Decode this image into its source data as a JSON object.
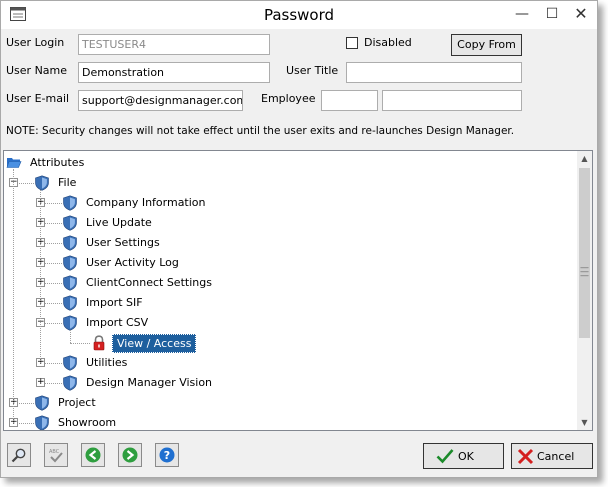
{
  "window": {
    "title": "Password"
  },
  "form": {
    "login_label": "User Login",
    "login_value": "TESTUSER4",
    "disabled_label": "Disabled",
    "disabled_checked": false,
    "copy_from_label": "Copy From",
    "name_label": "User Name",
    "name_value": "Demonstration",
    "title_label": "User Title",
    "title_value": "",
    "email_label": "User E-mail",
    "email_value": "support@designmanager.com",
    "employee_label": "Employee",
    "employee_code": "",
    "employee_name": ""
  },
  "note": "NOTE: Security changes will not take effect until the user exits and re-launches Design Manager.",
  "tree": {
    "root": "Attributes",
    "nodes": [
      {
        "label": "File",
        "level": 1,
        "expanded": true
      },
      {
        "label": "Company Information",
        "level": 2,
        "expanded": false
      },
      {
        "label": "Live Update",
        "level": 2,
        "expanded": false
      },
      {
        "label": "User Settings",
        "level": 2,
        "expanded": false
      },
      {
        "label": "User Activity Log",
        "level": 2,
        "expanded": false
      },
      {
        "label": "ClientConnect Settings",
        "level": 2,
        "expanded": false
      },
      {
        "label": "Import SIF",
        "level": 2,
        "expanded": false
      },
      {
        "label": "Import CSV",
        "level": 2,
        "expanded": true
      },
      {
        "label": "View / Access",
        "level": 3,
        "selected": true
      },
      {
        "label": "Utilities",
        "level": 2,
        "expanded": false
      },
      {
        "label": "Design Manager Vision",
        "level": 2,
        "expanded": false
      },
      {
        "label": "Project",
        "level": 1,
        "expanded": false
      },
      {
        "label": "Showroom",
        "level": 1,
        "expanded": false
      }
    ]
  },
  "toolbar": {
    "icons": [
      "search-icon",
      "spell-check-icon",
      "back-icon",
      "forward-icon",
      "help-icon"
    ]
  },
  "buttons": {
    "ok": "OK",
    "cancel": "Cancel"
  },
  "colors": {
    "selection": "#1e5f9e",
    "shield": "#3a6fb5",
    "go_green": "#2e9e3f",
    "help_blue": "#1f6fd0",
    "cancel_red": "#d42020",
    "ok_green": "#1b8a2a"
  }
}
